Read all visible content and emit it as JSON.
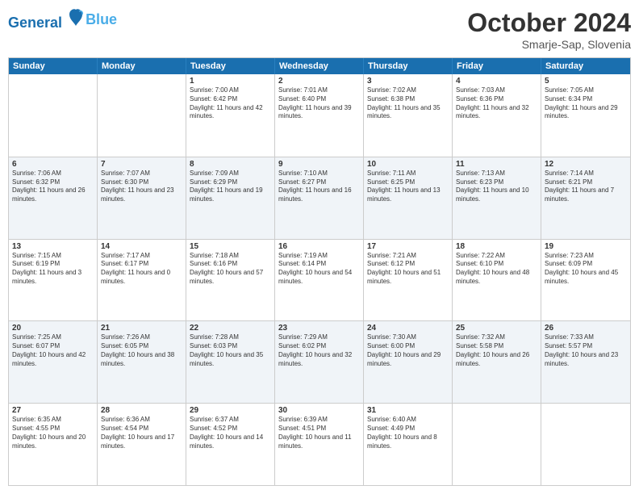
{
  "header": {
    "logo_line1": "General",
    "logo_line2": "Blue",
    "month": "October 2024",
    "location": "Smarje-Sap, Slovenia"
  },
  "weekdays": [
    "Sunday",
    "Monday",
    "Tuesday",
    "Wednesday",
    "Thursday",
    "Friday",
    "Saturday"
  ],
  "rows": [
    [
      {
        "day": "",
        "text": ""
      },
      {
        "day": "",
        "text": ""
      },
      {
        "day": "1",
        "text": "Sunrise: 7:00 AM\nSunset: 6:42 PM\nDaylight: 11 hours and 42 minutes."
      },
      {
        "day": "2",
        "text": "Sunrise: 7:01 AM\nSunset: 6:40 PM\nDaylight: 11 hours and 39 minutes."
      },
      {
        "day": "3",
        "text": "Sunrise: 7:02 AM\nSunset: 6:38 PM\nDaylight: 11 hours and 35 minutes."
      },
      {
        "day": "4",
        "text": "Sunrise: 7:03 AM\nSunset: 6:36 PM\nDaylight: 11 hours and 32 minutes."
      },
      {
        "day": "5",
        "text": "Sunrise: 7:05 AM\nSunset: 6:34 PM\nDaylight: 11 hours and 29 minutes."
      }
    ],
    [
      {
        "day": "6",
        "text": "Sunrise: 7:06 AM\nSunset: 6:32 PM\nDaylight: 11 hours and 26 minutes."
      },
      {
        "day": "7",
        "text": "Sunrise: 7:07 AM\nSunset: 6:30 PM\nDaylight: 11 hours and 23 minutes."
      },
      {
        "day": "8",
        "text": "Sunrise: 7:09 AM\nSunset: 6:29 PM\nDaylight: 11 hours and 19 minutes."
      },
      {
        "day": "9",
        "text": "Sunrise: 7:10 AM\nSunset: 6:27 PM\nDaylight: 11 hours and 16 minutes."
      },
      {
        "day": "10",
        "text": "Sunrise: 7:11 AM\nSunset: 6:25 PM\nDaylight: 11 hours and 13 minutes."
      },
      {
        "day": "11",
        "text": "Sunrise: 7:13 AM\nSunset: 6:23 PM\nDaylight: 11 hours and 10 minutes."
      },
      {
        "day": "12",
        "text": "Sunrise: 7:14 AM\nSunset: 6:21 PM\nDaylight: 11 hours and 7 minutes."
      }
    ],
    [
      {
        "day": "13",
        "text": "Sunrise: 7:15 AM\nSunset: 6:19 PM\nDaylight: 11 hours and 3 minutes."
      },
      {
        "day": "14",
        "text": "Sunrise: 7:17 AM\nSunset: 6:17 PM\nDaylight: 11 hours and 0 minutes."
      },
      {
        "day": "15",
        "text": "Sunrise: 7:18 AM\nSunset: 6:16 PM\nDaylight: 10 hours and 57 minutes."
      },
      {
        "day": "16",
        "text": "Sunrise: 7:19 AM\nSunset: 6:14 PM\nDaylight: 10 hours and 54 minutes."
      },
      {
        "day": "17",
        "text": "Sunrise: 7:21 AM\nSunset: 6:12 PM\nDaylight: 10 hours and 51 minutes."
      },
      {
        "day": "18",
        "text": "Sunrise: 7:22 AM\nSunset: 6:10 PM\nDaylight: 10 hours and 48 minutes."
      },
      {
        "day": "19",
        "text": "Sunrise: 7:23 AM\nSunset: 6:09 PM\nDaylight: 10 hours and 45 minutes."
      }
    ],
    [
      {
        "day": "20",
        "text": "Sunrise: 7:25 AM\nSunset: 6:07 PM\nDaylight: 10 hours and 42 minutes."
      },
      {
        "day": "21",
        "text": "Sunrise: 7:26 AM\nSunset: 6:05 PM\nDaylight: 10 hours and 38 minutes."
      },
      {
        "day": "22",
        "text": "Sunrise: 7:28 AM\nSunset: 6:03 PM\nDaylight: 10 hours and 35 minutes."
      },
      {
        "day": "23",
        "text": "Sunrise: 7:29 AM\nSunset: 6:02 PM\nDaylight: 10 hours and 32 minutes."
      },
      {
        "day": "24",
        "text": "Sunrise: 7:30 AM\nSunset: 6:00 PM\nDaylight: 10 hours and 29 minutes."
      },
      {
        "day": "25",
        "text": "Sunrise: 7:32 AM\nSunset: 5:58 PM\nDaylight: 10 hours and 26 minutes."
      },
      {
        "day": "26",
        "text": "Sunrise: 7:33 AM\nSunset: 5:57 PM\nDaylight: 10 hours and 23 minutes."
      }
    ],
    [
      {
        "day": "27",
        "text": "Sunrise: 6:35 AM\nSunset: 4:55 PM\nDaylight: 10 hours and 20 minutes."
      },
      {
        "day": "28",
        "text": "Sunrise: 6:36 AM\nSunset: 4:54 PM\nDaylight: 10 hours and 17 minutes."
      },
      {
        "day": "29",
        "text": "Sunrise: 6:37 AM\nSunset: 4:52 PM\nDaylight: 10 hours and 14 minutes."
      },
      {
        "day": "30",
        "text": "Sunrise: 6:39 AM\nSunset: 4:51 PM\nDaylight: 10 hours and 11 minutes."
      },
      {
        "day": "31",
        "text": "Sunrise: 6:40 AM\nSunset: 4:49 PM\nDaylight: 10 hours and 8 minutes."
      },
      {
        "day": "",
        "text": ""
      },
      {
        "day": "",
        "text": ""
      }
    ]
  ]
}
